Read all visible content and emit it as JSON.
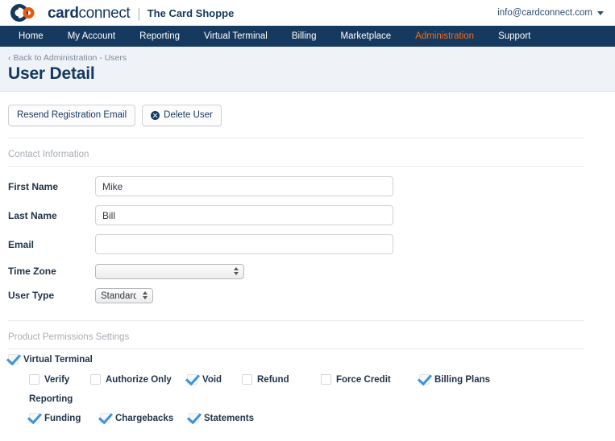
{
  "header": {
    "logo_word_bold": "card",
    "logo_word_light": "connect",
    "separator": "|",
    "tenant": "The Card Shoppe",
    "account_email": "info@cardconnect.com",
    "caret_icon": "chevron-down-icon"
  },
  "nav": {
    "items": [
      {
        "label": "Home",
        "active": false
      },
      {
        "label": "My Account",
        "active": false
      },
      {
        "label": "Reporting",
        "active": false
      },
      {
        "label": "Virtual Terminal",
        "active": false
      },
      {
        "label": "Billing",
        "active": false
      },
      {
        "label": "Marketplace",
        "active": false
      },
      {
        "label": "Administration",
        "active": true
      },
      {
        "label": "Support",
        "active": false
      }
    ],
    "active_color": "#ef6c1a",
    "background": "#163a5f"
  },
  "pagehead": {
    "breadcrumb_chevron": "‹",
    "breadcrumb": "Back to Administration - Users",
    "title": "User Detail",
    "background": "#eff3f8"
  },
  "actions": {
    "resend_label": "Resend Registration Email",
    "delete_label": "Delete User",
    "delete_icon": "x-circle-icon"
  },
  "contact": {
    "section_label": "Contact Information",
    "first_name_label": "First Name",
    "first_name_value": "Mike",
    "last_name_label": "Last Name",
    "last_name_value": "Bill",
    "email_label": "Email",
    "email_value": "",
    "timezone_label": "Time Zone",
    "timezone_value": "",
    "usertype_label": "User Type",
    "usertype_value": "Standard"
  },
  "permissions": {
    "section_label": "Product Permissions Settings",
    "virtual_terminal": {
      "label": "Virtual Terminal",
      "checked": true
    },
    "vt_children": [
      {
        "label": "Verify",
        "checked": false
      },
      {
        "label": "Authorize Only",
        "checked": false
      },
      {
        "label": "Void",
        "checked": true
      },
      {
        "label": "Refund",
        "checked": false
      },
      {
        "label": "Force Credit",
        "checked": false
      },
      {
        "label": "Billing Plans",
        "checked": true
      }
    ],
    "reporting_label": "Reporting",
    "reporting_children": [
      {
        "label": "Funding",
        "checked": true
      },
      {
        "label": "Chargebacks",
        "checked": true
      },
      {
        "label": "Statements",
        "checked": true
      }
    ],
    "check_color": "#3e94d8"
  }
}
